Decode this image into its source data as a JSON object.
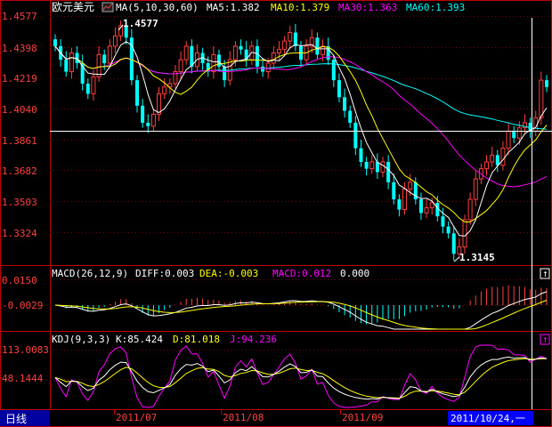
{
  "window": {
    "title": "欧元美元",
    "bottom_tab": "日线"
  },
  "colors": {
    "up": "#ff3f3f",
    "down": "#00ffff",
    "ma5": "#ffffff",
    "ma10": "#ffff00",
    "ma30": "#ff00ff",
    "ma60": "#00ffff",
    "axis": "#c00000",
    "label": "#ff4040",
    "cursor": "#0000ff"
  },
  "main": {
    "ma_header": {
      "icon": "chart-icon",
      "params": "MA(5,10,30,60)",
      "ma5": "MA5:1.382",
      "ma10": "MA10:1.379",
      "ma30": "MA30:1.363",
      "ma60": "MA60:1.393"
    },
    "yaxis_labels": [
      "1.4577",
      "1.4398",
      "1.4219",
      "1.4040",
      "1.3861",
      "1.3682",
      "1.3503",
      "1.3324"
    ],
    "high_label": "1.4577",
    "low_label": "1.3145"
  },
  "macd": {
    "params": "MACD(26,12,9)",
    "diff": "DIFF:0.003",
    "dea": "DEA:-0.003",
    "macd": "MACD:0.012",
    "extra": "0.000",
    "yaxis_labels": [
      "0.0150",
      "-0.0029"
    ]
  },
  "kdj": {
    "params": "KDJ(9,3,3)",
    "k": "K:85.424",
    "d": "D:81.018",
    "j": "J:94.236",
    "yaxis_labels": [
      "113.0083",
      "48.1444"
    ]
  },
  "xaxis_labels": [
    "2011/07",
    "2011/08",
    "2011/09"
  ],
  "cursor_date": "2011/10/24,一",
  "chart_data": {
    "type": "candlestick",
    "title": "欧元美元",
    "ylim": [
      1.3145,
      1.4577
    ],
    "xlabels": [
      "2011/07",
      "2011/08",
      "2011/09"
    ],
    "close_series": [
      1.44,
      1.432,
      1.425,
      1.436,
      1.43,
      1.418,
      1.412,
      1.422,
      1.435,
      1.43,
      1.44,
      1.446,
      1.452,
      1.445,
      1.42,
      1.405,
      1.395,
      1.393,
      1.4,
      1.412,
      1.416,
      1.418,
      1.425,
      1.432,
      1.44,
      1.428,
      1.436,
      1.43,
      1.425,
      1.435,
      1.428,
      1.42,
      1.432,
      1.44,
      1.438,
      1.432,
      1.44,
      1.428,
      1.425,
      1.43,
      1.436,
      1.438,
      1.443,
      1.448,
      1.44,
      1.432,
      1.44,
      1.445,
      1.435,
      1.44,
      1.432,
      1.42,
      1.41,
      1.402,
      1.395,
      1.38,
      1.372,
      1.368,
      1.372,
      1.366,
      1.372,
      1.36,
      1.35,
      1.344,
      1.356,
      1.36,
      1.35,
      1.342,
      1.345,
      1.348,
      1.34,
      1.334,
      1.33,
      1.318,
      1.322,
      1.338,
      1.35,
      1.362,
      1.368,
      1.372,
      1.376,
      1.37,
      1.38,
      1.39,
      1.386,
      1.392,
      1.395,
      1.39,
      1.398,
      1.42,
      1.416
    ],
    "ma_values": {
      "MA5": 1.382,
      "MA10": 1.379,
      "MA30": 1.363,
      "MA60": 1.393
    },
    "high": 1.4577,
    "low": 1.3145
  }
}
